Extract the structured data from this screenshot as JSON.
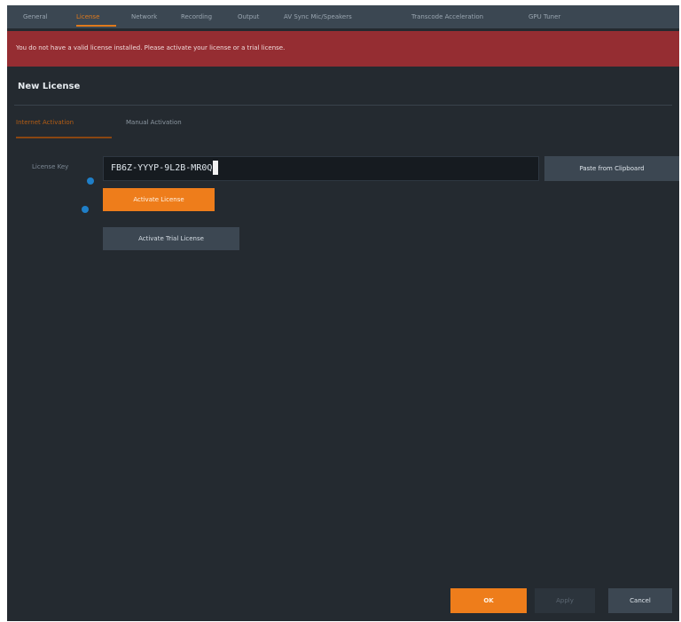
{
  "tabs": [
    {
      "label": "General",
      "active": false
    },
    {
      "label": "License",
      "active": true
    },
    {
      "label": "Network",
      "active": false
    },
    {
      "label": "Recording",
      "active": false
    },
    {
      "label": "Output",
      "active": false
    },
    {
      "label": "AV Sync Mic/Speakers",
      "active": false
    },
    {
      "label": "Transcode Acceleration",
      "active": false
    },
    {
      "label": "GPU Tuner",
      "active": false
    }
  ],
  "alert": {
    "message": "You do not have a valid license installed. Please activate your license or a trial license."
  },
  "section": {
    "title": "New License"
  },
  "subtabs": [
    {
      "label": "Internet Activation",
      "active": true
    },
    {
      "label": "Manual Activation",
      "active": false
    }
  ],
  "license_field": {
    "label": "License Key",
    "value": "FB6Z-YYYP-9L2B-MR0Q"
  },
  "buttons": {
    "paste": "Paste from Clipboard",
    "activate": "Activate License",
    "activate_trial": "Activate Trial License",
    "ok": "OK",
    "apply": "Apply",
    "cancel": "Cancel"
  },
  "colors": {
    "accent": "#ee7d1b",
    "alert_bg": "#952d32",
    "window_bg": "#242a30",
    "radio": "#1f7fc8"
  }
}
